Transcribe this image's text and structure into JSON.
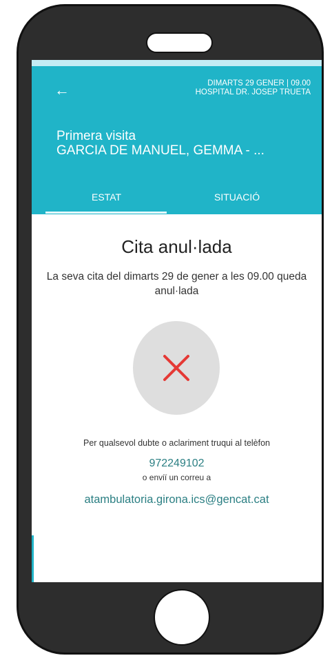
{
  "header": {
    "back_icon": "arrow-left-icon",
    "date_line": "DIMARTS 29 GENER | 09.00",
    "hospital_line": "HOSPITAL DR. JOSEP TRUETA",
    "visit_type": "Primera visita",
    "patient_name": "GARCIA DE MANUEL, GEMMA - ..."
  },
  "tabs": [
    {
      "label": "ESTAT",
      "selected": true
    },
    {
      "label": "SITUACIÓ",
      "selected": false
    }
  ],
  "status": {
    "title": "Cita anul·lada",
    "message": "La seva cita del dimarts 29 de gener a les 09.00 queda anul·lada",
    "icon": "cancel-x-icon"
  },
  "contact": {
    "help_text": "Per qualsevol dubte o aclariment truqui al telèfon",
    "phone": "972249102",
    "or_email_text": "o enviï un correu a",
    "email": "atambulatoria.girona.ics@gencat.cat"
  },
  "colors": {
    "header_bg": "#20b4c8",
    "link": "#2b7f83",
    "cancel_x": "#e53935",
    "cancel_circle": "#dedede",
    "phone_frame": "#2d2d2d"
  }
}
